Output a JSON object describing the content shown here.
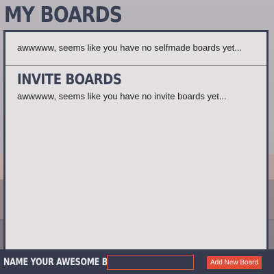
{
  "header": {
    "title": "MY BOARDS"
  },
  "selfmade": {
    "empty_message": "awwwww, seems like you have no selfmade boards yet..."
  },
  "invite": {
    "title": "INVITE BOARDS",
    "empty_message": "awwwww, seems like you have no invite boards yet..."
  },
  "new_board": {
    "label": "NAME YOUR AWESOME BOARD:",
    "input_value": "",
    "button_label": "Add New Board"
  },
  "colors": {
    "heading": "#3a4053",
    "panel": "#e3e1e2",
    "bottom_bar": "#353b4d",
    "accent": "#e24b35"
  }
}
